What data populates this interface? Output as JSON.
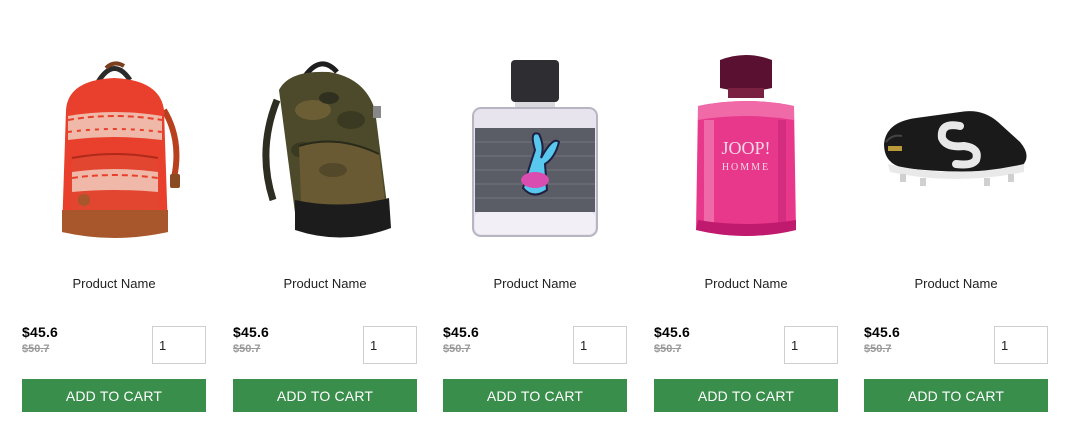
{
  "products": [
    {
      "image": "red-backpack",
      "name": "Product Name",
      "price": "$45.6",
      "old_price": "$50.7",
      "qty": "1",
      "button": "ADD TO CART"
    },
    {
      "image": "camo-backpack",
      "name": "Product Name",
      "price": "$45.6",
      "old_price": "$50.7",
      "qty": "1",
      "button": "ADD TO CART"
    },
    {
      "image": "playboy-perfume",
      "name": "Product Name",
      "price": "$45.6",
      "old_price": "$50.7",
      "qty": "1",
      "button": "ADD TO CART"
    },
    {
      "image": "joop-perfume",
      "name": "Product Name",
      "price": "$45.6",
      "old_price": "$50.7",
      "qty": "1",
      "button": "ADD TO CART"
    },
    {
      "image": "football-boot",
      "name": "Product Name",
      "price": "$45.6",
      "old_price": "$50.7",
      "qty": "1",
      "button": "ADD TO CART"
    }
  ],
  "product_4_logo": {
    "line1": "JOOP!",
    "line2": "HOMME"
  },
  "colors": {
    "button_bg": "#3a8e4b",
    "button_text": "#ffffff"
  }
}
